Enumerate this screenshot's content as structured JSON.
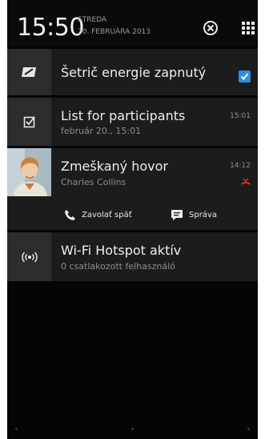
{
  "status": {
    "time": "15:50",
    "day": "STREDA",
    "date": "20. FEBRUÁRA 2013",
    "clear_icon": "close-circle-icon",
    "grid_icon": "grid-icon"
  },
  "notifications": [
    {
      "title": "Šetrič energie zapnutý",
      "icon": "battery-saver-icon",
      "checked": true
    },
    {
      "title": "List for participants",
      "subtitle": "február 20., 15:01",
      "time": "15:01",
      "icon": "checkbox-task-icon"
    },
    {
      "title": "Zmeškaný hovor",
      "subtitle": "Charles Collins",
      "time": "14:12",
      "icon": "missed-call-icon",
      "actions": [
        {
          "label": "Zavolať späť",
          "icon": "phone-icon"
        },
        {
          "label": "Správa",
          "icon": "message-icon"
        }
      ]
    },
    {
      "title": "Wi-Fi Hotspot aktív",
      "subtitle": "0 csatlakozott felhasználó",
      "icon": "hotspot-icon"
    }
  ],
  "colors": {
    "accent": "#2f8fe0",
    "missed": "#d33333"
  }
}
